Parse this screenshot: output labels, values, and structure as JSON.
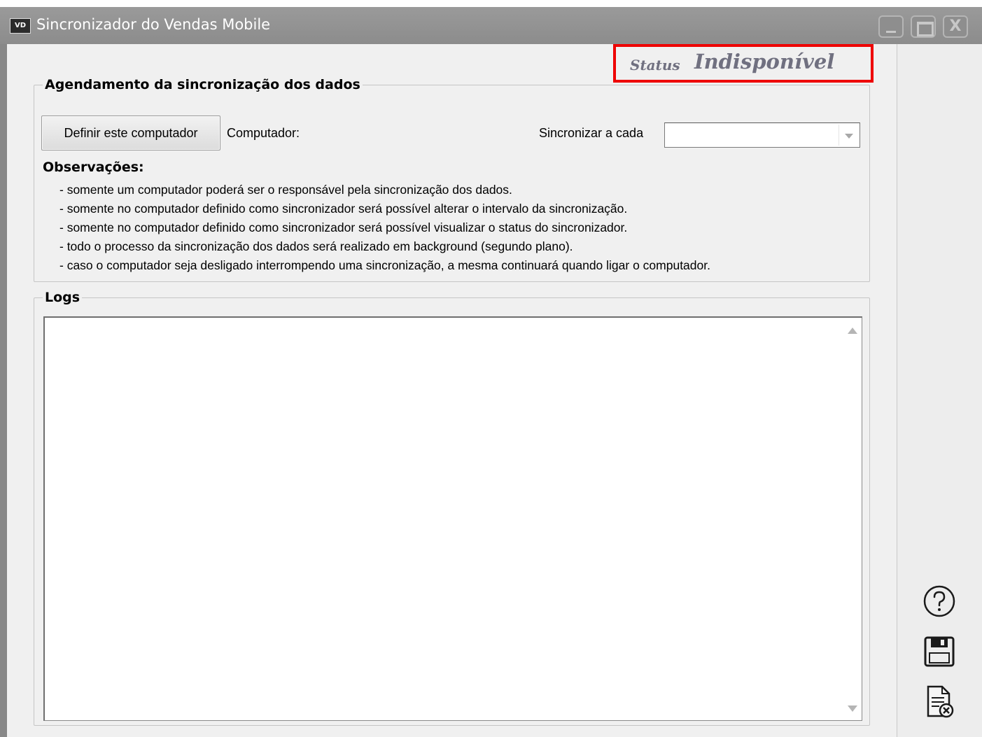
{
  "window": {
    "app_icon_text": "VD",
    "title": "Sincronizador do Vendas Mobile",
    "controls": {
      "minimize_icon": "minimize-icon",
      "maximize_icon": "maximize-icon",
      "close_label": "X"
    }
  },
  "status": {
    "label": "Status",
    "value": "Indisponível",
    "highlight_color": "#ee0000"
  },
  "agendamento": {
    "title": "Agendamento da sincronização dos dados",
    "define_button": "Definir este computador",
    "computador_label": "Computador:",
    "sincronizar_label": "Sincronizar a cada",
    "sincronizar_value": ""
  },
  "observacoes": {
    "title": "Observações:",
    "items": [
      "- somente um computador poderá ser o responsável pela sincronização dos dados.",
      "- somente no computador definido como sincronizador será possível alterar o intervalo da sincronização.",
      "- somente no computador definido como sincronizador será possível visualizar o status do sincronizador.",
      "- todo o processo da sincronização dos dados será realizado em background (segundo plano).",
      "- caso o computador seja desligado interrompendo uma sincronização, a mesma continuará quando ligar o computador."
    ]
  },
  "logs": {
    "title": "Logs",
    "content": ""
  },
  "side_toolbar": {
    "icons": [
      "help-icon",
      "save-icon",
      "cancel-document-icon"
    ]
  }
}
